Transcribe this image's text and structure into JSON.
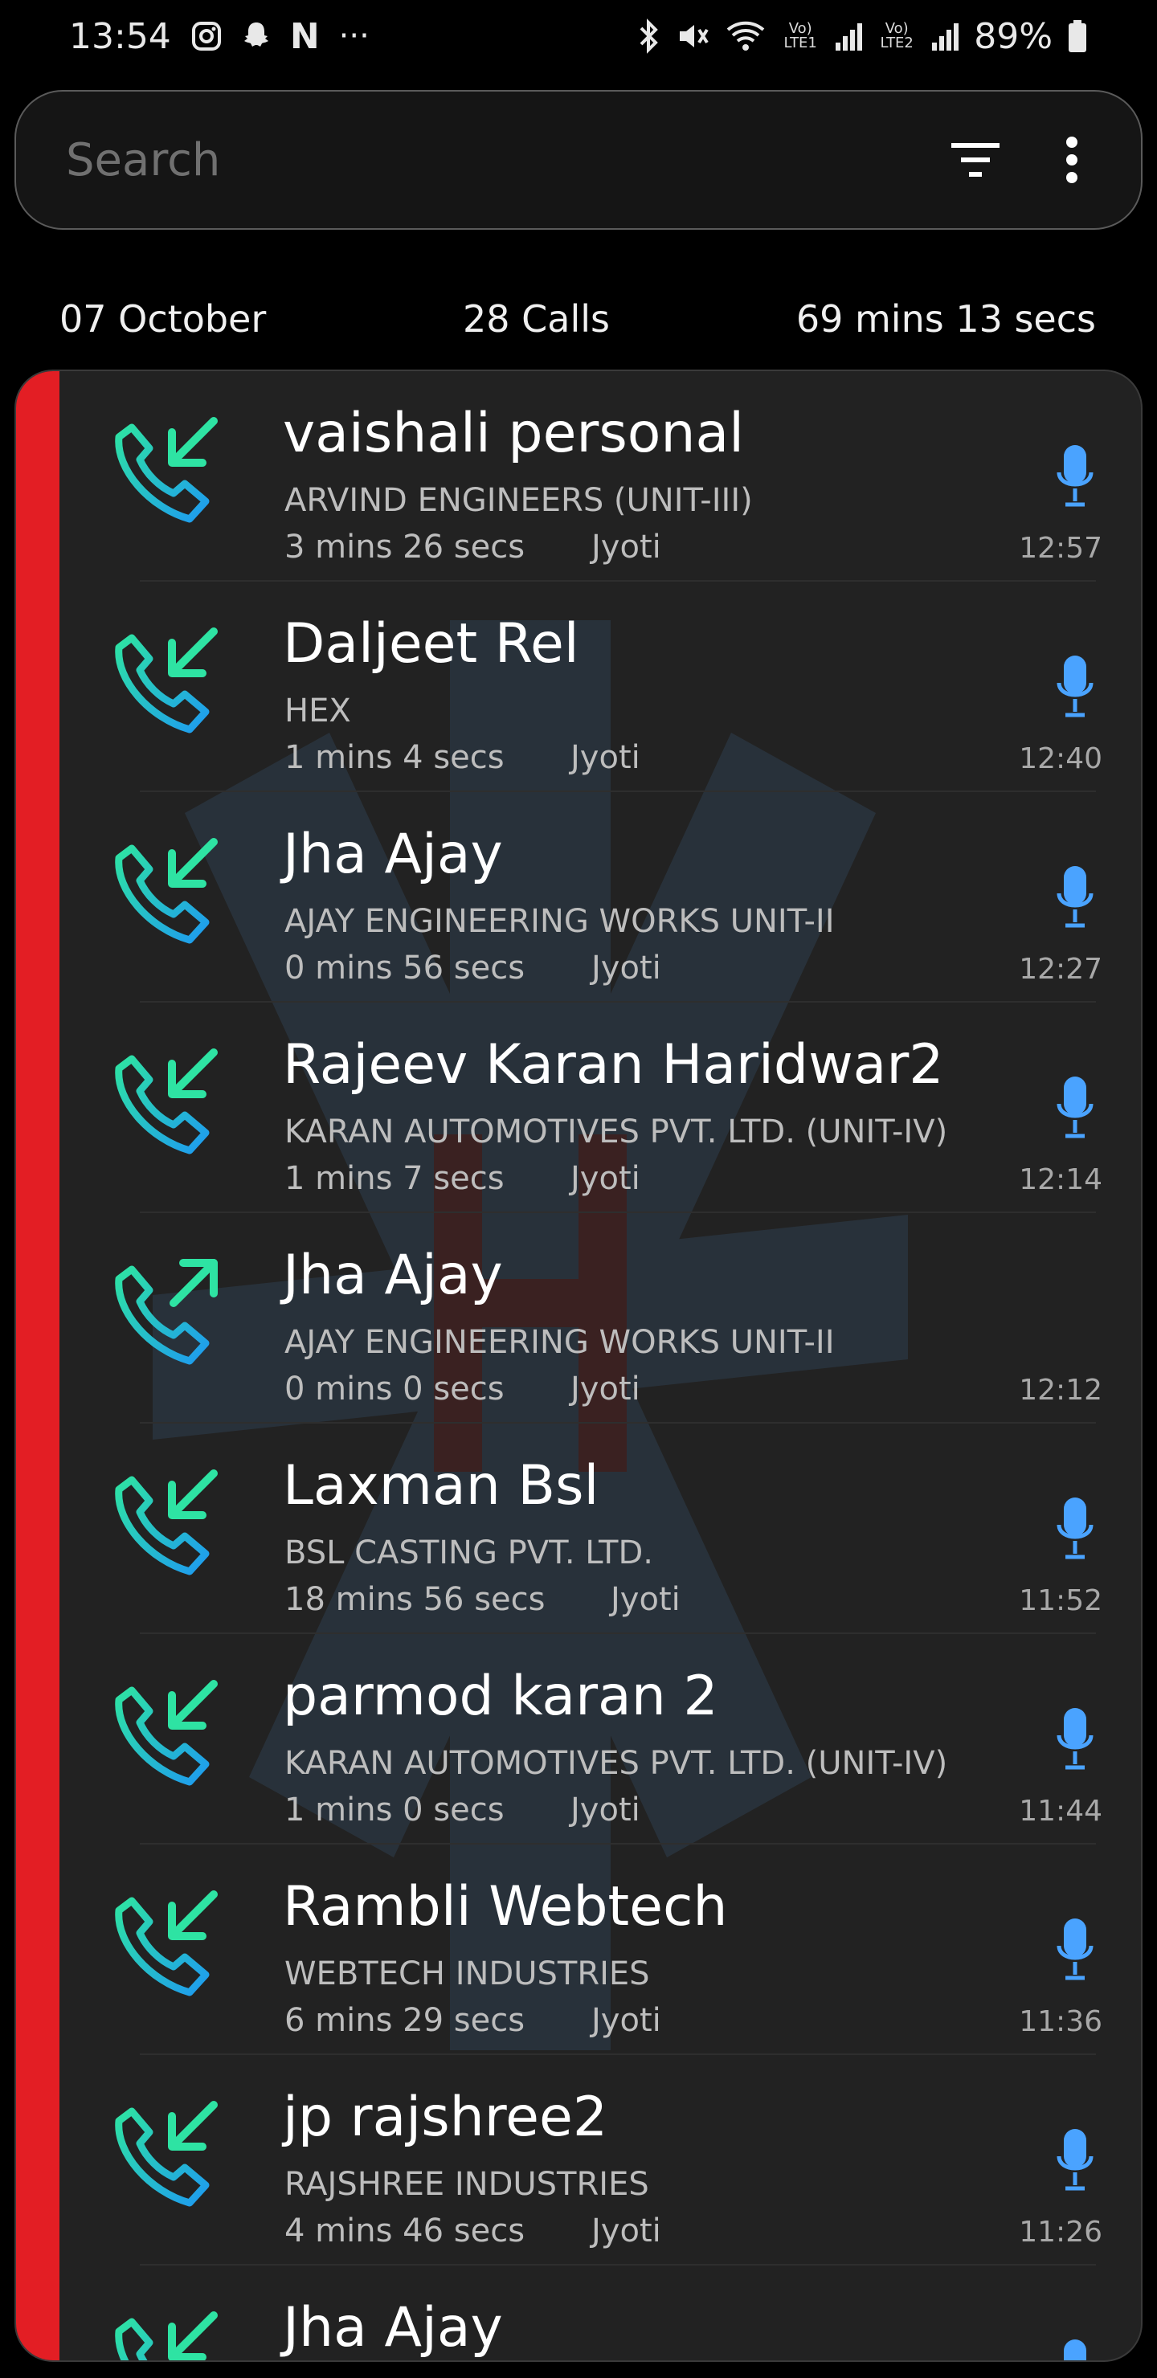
{
  "status_bar": {
    "time": "13:54",
    "left_icons": [
      "instagram-icon",
      "snapchat-icon",
      "netflix-icon",
      "more-notifications-icon"
    ],
    "more_label": "···",
    "netflix_label": "N",
    "sim1_label": "Vo) LTE1",
    "sim2_label": "Vo) LTE2",
    "battery": "89%"
  },
  "search": {
    "placeholder": "Search"
  },
  "summary": {
    "date": "07 October",
    "calls": "28 Calls",
    "duration": "69 mins 13 secs"
  },
  "colors": {
    "accent_red": "#e31e24",
    "incoming_green": "#2ee3a3",
    "call_blue": "#1e9bf0",
    "mic_blue": "#4aa3ff"
  },
  "calls": [
    {
      "name": "vaishali personal",
      "company": "ARVIND ENGINEERS (UNIT-III)",
      "duration": "3 mins 26 secs",
      "agent": "Jyoti",
      "time": "12:57",
      "direction": "incoming",
      "recording": true
    },
    {
      "name": "Daljeet Rel",
      "company": "HEX",
      "duration": "1 mins 4 secs",
      "agent": "Jyoti",
      "time": "12:40",
      "direction": "incoming",
      "recording": true
    },
    {
      "name": "Jha Ajay",
      "company": "AJAY ENGINEERING WORKS UNIT-II",
      "duration": "0 mins 56 secs",
      "agent": "Jyoti",
      "time": "12:27",
      "direction": "incoming",
      "recording": true
    },
    {
      "name": "Rajeev Karan Haridwar2",
      "company": "KARAN AUTOMOTIVES PVT. LTD. (UNIT-IV)",
      "duration": "1 mins 7 secs",
      "agent": "Jyoti",
      "time": "12:14",
      "direction": "incoming",
      "recording": true
    },
    {
      "name": "Jha Ajay",
      "company": "AJAY ENGINEERING WORKS UNIT-II",
      "duration": "0 mins 0 secs",
      "agent": "Jyoti",
      "time": "12:12",
      "direction": "outgoing",
      "recording": false
    },
    {
      "name": "Laxman Bsl",
      "company": "BSL CASTING PVT. LTD.",
      "duration": "18 mins 56 secs",
      "agent": "Jyoti",
      "time": "11:52",
      "direction": "incoming",
      "recording": true
    },
    {
      "name": "parmod karan 2",
      "company": "KARAN AUTOMOTIVES PVT. LTD. (UNIT-IV)",
      "duration": "1 mins 0 secs",
      "agent": "Jyoti",
      "time": "11:44",
      "direction": "incoming",
      "recording": true
    },
    {
      "name": "Rambli Webtech",
      "company": "WEBTECH INDUSTRIES",
      "duration": "6 mins 29 secs",
      "agent": "Jyoti",
      "time": "11:36",
      "direction": "incoming",
      "recording": true
    },
    {
      "name": "jp rajshree2",
      "company": "RAJSHREE INDUSTRIES",
      "duration": "4 mins 46 secs",
      "agent": "Jyoti",
      "time": "11:26",
      "direction": "incoming",
      "recording": true
    },
    {
      "name": "Jha Ajay",
      "company": "",
      "duration": "",
      "agent": "",
      "time": "",
      "direction": "incoming",
      "recording": true
    }
  ]
}
